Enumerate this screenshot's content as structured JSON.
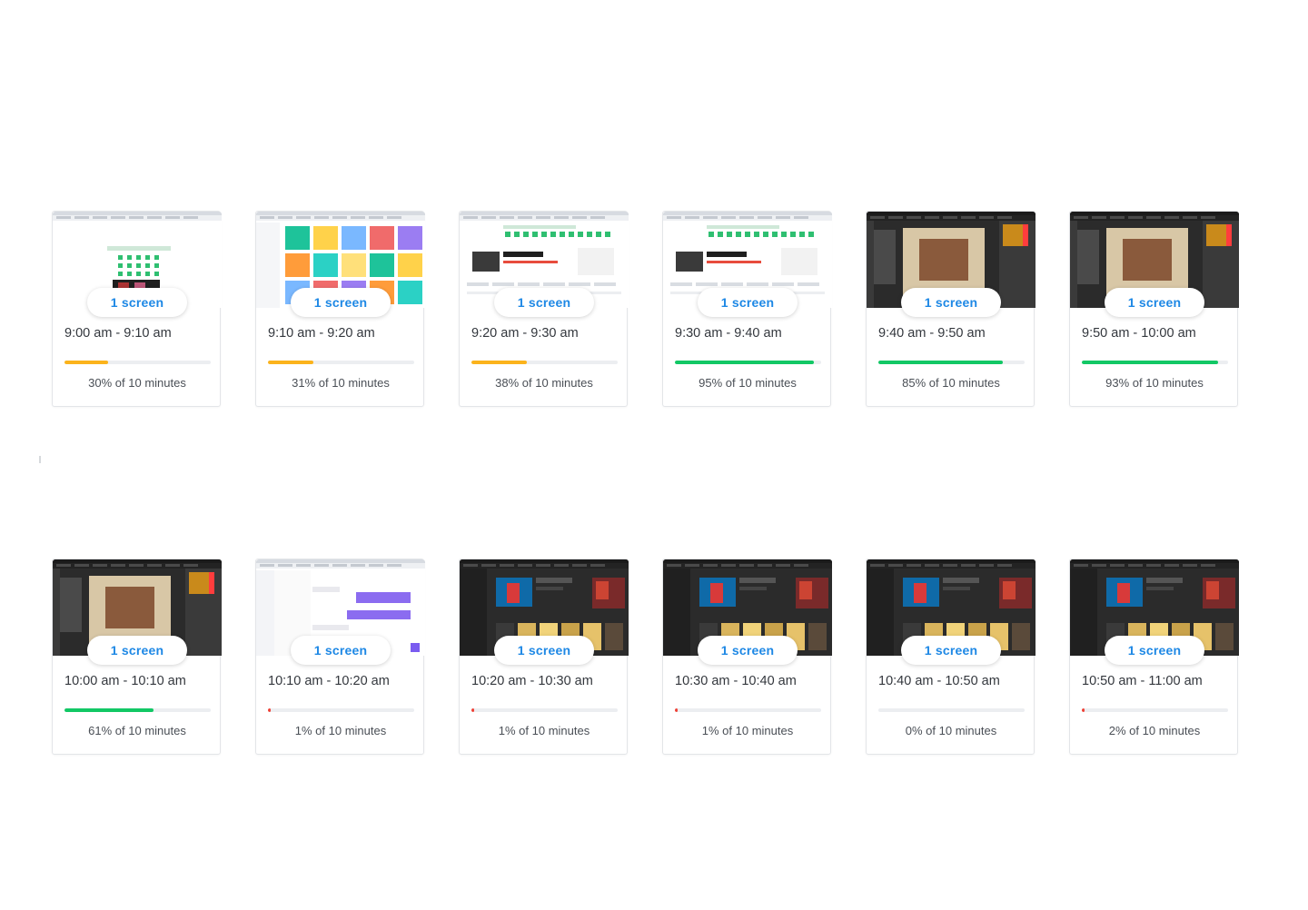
{
  "colors": {
    "good": "#12c865",
    "mid": "#fbb31c",
    "low": "#ef4136",
    "accent": "#1e88e5"
  },
  "cards": [
    {
      "screens_label": "1 screen",
      "time_range": "9:00 am - 9:10 am",
      "activity_label": "30% of 10 minutes",
      "activity": 30,
      "theme": "light",
      "level_color": "mid"
    },
    {
      "screens_label": "1 screen",
      "time_range": "9:10 am - 9:20 am",
      "activity_label": "31% of 10 minutes",
      "activity": 31,
      "theme": "light-design",
      "level_color": "mid"
    },
    {
      "screens_label": "1 screen",
      "time_range": "9:20 am - 9:30 am",
      "activity_label": "38% of 10 minutes",
      "activity": 38,
      "theme": "light-shop",
      "level_color": "mid"
    },
    {
      "screens_label": "1 screen",
      "time_range": "9:30 am - 9:40 am",
      "activity_label": "95% of 10 minutes",
      "activity": 95,
      "theme": "light-shop",
      "level_color": "good"
    },
    {
      "screens_label": "1 screen",
      "time_range": "9:40 am - 9:50 am",
      "activity_label": "85% of 10 minutes",
      "activity": 85,
      "theme": "dark-editor",
      "level_color": "good"
    },
    {
      "screens_label": "1 screen",
      "time_range": "9:50 am - 10:00 am",
      "activity_label": "93% of 10 minutes",
      "activity": 93,
      "theme": "dark-editor",
      "level_color": "good"
    },
    {
      "screens_label": "1 screen",
      "time_range": "10:00 am - 10:10 am",
      "activity_label": "61% of 10 minutes",
      "activity": 61,
      "theme": "dark-editor",
      "level_color": "good"
    },
    {
      "screens_label": "1 screen",
      "time_range": "10:10 am - 10:20 am",
      "activity_label": "1% of 10 minutes",
      "activity": 1,
      "theme": "light-chat",
      "level_color": "low"
    },
    {
      "screens_label": "1 screen",
      "time_range": "10:20 am - 10:30 am",
      "activity_label": "1% of 10 minutes",
      "activity": 1,
      "theme": "dark-media",
      "level_color": "low"
    },
    {
      "screens_label": "1 screen",
      "time_range": "10:30 am - 10:40 am",
      "activity_label": "1% of 10 minutes",
      "activity": 1,
      "theme": "dark-media",
      "level_color": "low"
    },
    {
      "screens_label": "1 screen",
      "time_range": "10:40 am - 10:50 am",
      "activity_label": "0% of 10 minutes",
      "activity": 0,
      "theme": "dark-media",
      "level_color": "low"
    },
    {
      "screens_label": "1 screen",
      "time_range": "10:50 am - 11:00 am",
      "activity_label": "2% of 10 minutes",
      "activity": 2,
      "theme": "dark-media",
      "level_color": "low"
    }
  ]
}
